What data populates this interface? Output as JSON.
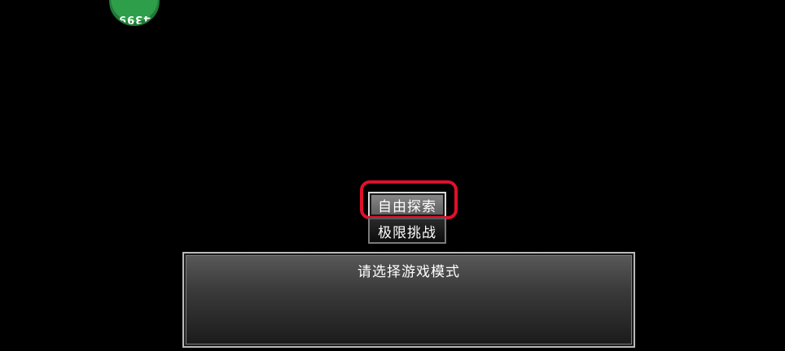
{
  "badge": {
    "text": "4399",
    "color": "#2e9e4a"
  },
  "modes": {
    "free_explore": "自由探索",
    "extreme_challenge": "极限挑战",
    "selected": "free_explore"
  },
  "panel": {
    "title": "请选择游戏模式"
  },
  "colors": {
    "background": "#000000",
    "highlight": "#e0102a"
  }
}
